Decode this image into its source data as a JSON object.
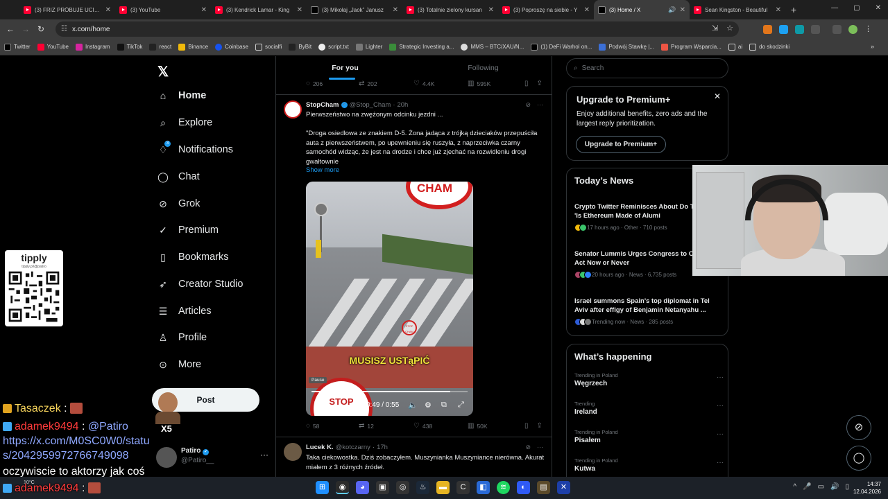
{
  "browser": {
    "tabs": [
      {
        "label": "(3) FRIZ PRÓBUJE UCISZYĆ",
        "icon": "youtube-icon"
      },
      {
        "label": "(3) YouTube",
        "icon": "youtube-icon"
      },
      {
        "label": "(3) Kendrick Lamar - King",
        "icon": "youtube-icon"
      },
      {
        "label": "(3) Mikołaj „Jaok” Janusz",
        "icon": "x-icon"
      },
      {
        "label": "(3) Totalnie zielony kursan",
        "icon": "youtube-icon"
      },
      {
        "label": "(3) Poproszę na siebie - Y",
        "icon": "youtube-icon"
      },
      {
        "label": "(3) Home / X",
        "icon": "x-icon"
      },
      {
        "label": "Sean Kingston - Beautiful",
        "icon": "youtube-icon"
      }
    ],
    "active_tab": 6,
    "url": "x.com/home",
    "bookmarks": [
      "Twitter",
      "YouTube",
      "Instagram",
      "TikTok",
      "react",
      "Binance",
      "Coinbase",
      "socialfi",
      "ByBit",
      "script.txt",
      "Lighter",
      "Strategic Investing a...",
      "MMS – BTC/XAU/N...",
      "(1) DeFi Warhol on...",
      "Podwój Stawkę  |...",
      "Program Wsparcia...",
      "ai",
      "do skodzinki"
    ],
    "colors": {
      "tab_bg": "#1f1f1f",
      "toolbar_bg": "#3c3c3c"
    }
  },
  "sidebar": {
    "items": [
      {
        "label": "Home",
        "icon": "home-icon"
      },
      {
        "label": "Explore",
        "icon": "search-icon"
      },
      {
        "label": "Notifications",
        "icon": "bell-icon",
        "badge": "3"
      },
      {
        "label": "Chat",
        "icon": "chat-icon"
      },
      {
        "label": "Grok",
        "icon": "grok-icon"
      },
      {
        "label": "Premium",
        "icon": "premium-icon"
      },
      {
        "label": "Bookmarks",
        "icon": "bookmark-icon"
      },
      {
        "label": "Creator Studio",
        "icon": "rocket-icon"
      },
      {
        "label": "Articles",
        "icon": "article-icon"
      },
      {
        "label": "Profile",
        "icon": "person-icon"
      },
      {
        "label": "More",
        "icon": "more-circle-icon"
      }
    ],
    "post_label": "Post",
    "account": {
      "name": "Patiro",
      "handle": "@Patiro__"
    }
  },
  "timeline": {
    "tabs": [
      "For you",
      "Following"
    ],
    "prev_actions": {
      "replies": "206",
      "reposts": "202",
      "likes": "4.4K",
      "views": "595K"
    },
    "tweet": {
      "author": "StopCham",
      "handle": "@Stop_Cham",
      "time": "20h",
      "line1": "Pierwszeństwo na zwężonym odcinku jezdni ...",
      "body": "\"Droga osiedlowa ze znakiem D-5. Żona jadąca z trójką dzieciaków przepuściła auta z pierwszeństwem, po upewnieniu się ruszyła, z naprzeciwka czarny samochód widząc, że jest na drodze i chce już zjechać na rozwidleniu drogi gwałtownie",
      "show_more": "Show more",
      "video": {
        "sign_text": "CHAM",
        "logo_text": "STOP CHAM",
        "caption": "MUSISZ USTąPIĆ",
        "stop_text": "STOP",
        "tooltip": "Pause",
        "time": "0:49 / 0:55",
        "progress": 0.89
      },
      "actions": {
        "replies": "58",
        "reposts": "12",
        "likes": "438",
        "views": "50K"
      }
    },
    "next_tweet": {
      "author": "Lucek K.",
      "handle": "@kotczarny",
      "time": "17h",
      "text": "Taka ciekowostka. Dziś zobaczyłem. Muszynianka Muszyniance nierówna. Akurat miałem z 3 różnych źródeł."
    }
  },
  "right": {
    "search_placeholder": "Search",
    "premium": {
      "title": "Upgrade to Premium+",
      "body": "Enjoy additional benefits, zero ads and the largest reply prioritization.",
      "button": "Upgrade to Premium+"
    },
    "news": {
      "title": "Today’s News",
      "items": [
        {
          "headline": "Crypto Twitter Reminisces About Do Trump's 'Is Ethereum Made of Alumi",
          "meta": "17 hours ago · Other · 710 posts"
        },
        {
          "headline": "Senator Lummis Urges Congress to CLARITY Act Now or Never",
          "meta": "20 hours ago · News · 6,735 posts"
        },
        {
          "headline": "Israel summons Spain's top diplomat in Tel Aviv after effigy of Benjamin Netanyahu ...",
          "meta": "Trending now · News · 285 posts"
        }
      ]
    },
    "happening": {
      "title": "What’s happening",
      "trends": [
        {
          "label": "Trending in Poland",
          "name": "Węgrzech"
        },
        {
          "label": "Trending",
          "name": "Ireland"
        },
        {
          "label": "Trending in Poland",
          "name": "Pisałem"
        },
        {
          "label": "Trending in Poland",
          "name": "Kutwa"
        }
      ]
    }
  },
  "overlay": {
    "tipply": {
      "title": "tipply",
      "url": "tipply.pl/@patiro"
    },
    "chat": [
      {
        "user": "Tasaczek",
        "user_color": "#f5d35b",
        "badge_color": "#e0a31f",
        "text": ""
      },
      {
        "user": "adamek9494",
        "user_color": "#ff3b3b",
        "badge_color": "#3fa9f5",
        "text": "@Patiro"
      },
      {
        "user": "",
        "user_color": "#8fa8ff",
        "badge_color": "",
        "text": "https://x.com/M0SC0W0/statu"
      },
      {
        "user": "",
        "user_color": "#8fa8ff",
        "badge_color": "",
        "text": "s/2042959972766749098"
      },
      {
        "user": "",
        "user_color": "#ffffff",
        "badge_color": "",
        "text": "oczywiscie to aktorzy jak coś"
      },
      {
        "user": "adamek9494",
        "user_color": "#ff3b3b",
        "badge_color": "#3fa9f5",
        "text": ""
      }
    ],
    "sticker_label": "X5"
  },
  "taskbar": {
    "weather": "10°C",
    "time": "14:37",
    "date": "12.04.2026"
  }
}
